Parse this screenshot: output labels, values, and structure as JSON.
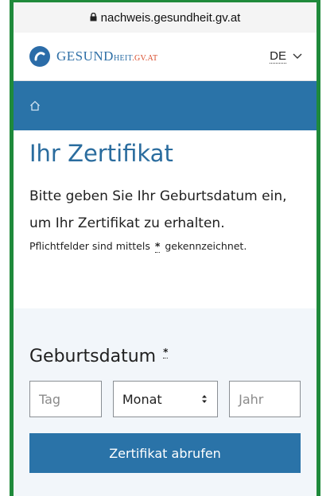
{
  "browser": {
    "url": "nachweis.gesundheit.gv.at"
  },
  "header": {
    "logo": {
      "main": "GESUND",
      "small": "HEIT",
      "domain": ".GV.AT"
    },
    "language": {
      "code": "DE"
    }
  },
  "page": {
    "title": "Ihr Zertifikat",
    "intro_line1": "Bitte geben Sie Ihr Geburtsdatum ein,",
    "intro_line2": "um Ihr Zertifikat zu erhalten.",
    "required_note_before": "Pflichtfelder sind mittels",
    "required_marker": "*",
    "required_note_after": "gekennzeichnet."
  },
  "form": {
    "label": "Geburtsdatum",
    "required_marker": "*",
    "day_placeholder": "Tag",
    "month_value": "Monat",
    "year_placeholder": "Jahr",
    "submit_label": "Zertifikat abrufen"
  },
  "colors": {
    "brand_blue": "#2a73a8",
    "frame_green": "#1f8a3b"
  }
}
